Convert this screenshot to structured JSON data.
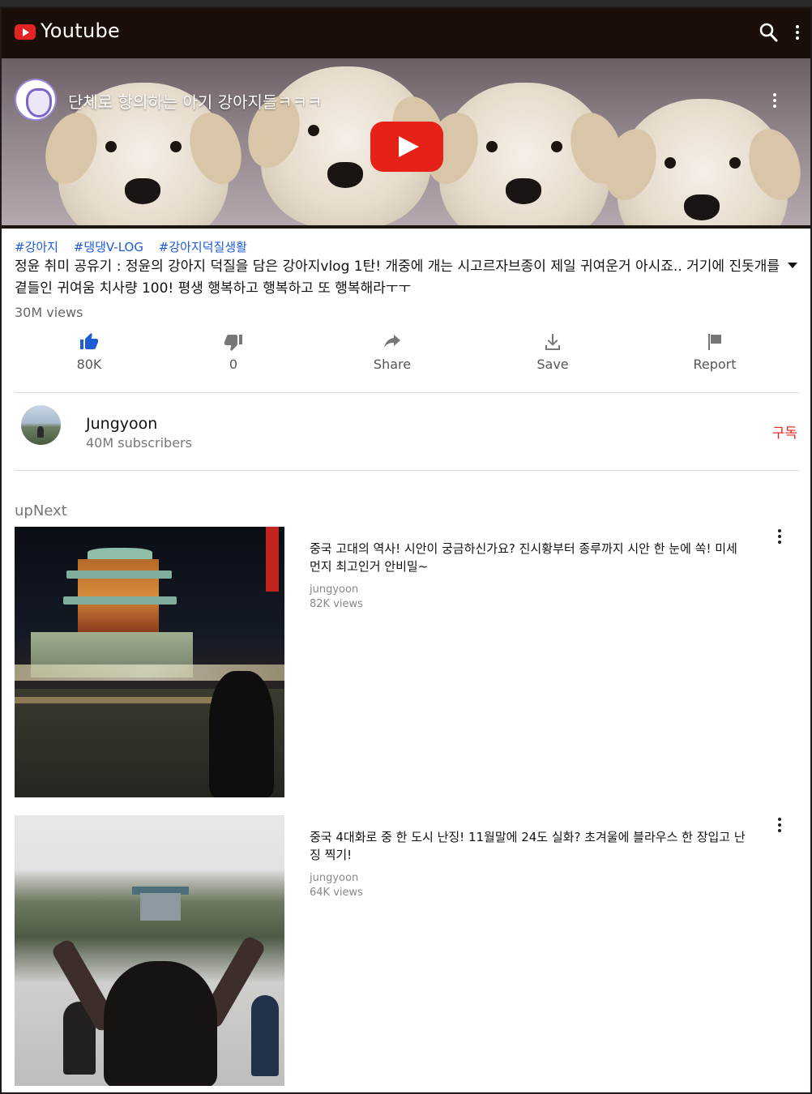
{
  "header": {
    "brand": "Youtube",
    "icons": [
      "youtube-logo-icon",
      "search-icon",
      "more-vert-icon"
    ],
    "colors": {
      "bar": "#1a0f08",
      "logo": "#e32424"
    }
  },
  "player": {
    "title": "단체로 항의하는 아기 강아지들ㅋㅋㅋ",
    "play_color": "#e62117"
  },
  "video": {
    "tags": [
      "#강아지",
      "#댕댕V-LOG",
      "#강아지덕질생활"
    ],
    "description": "정윤 취미 공유기 : 정윤의 강아지 덕질을 담은 강아지vlog 1탄! 개중에 개는 시고르자브종이 제일 귀여운거 아시죠.. 거기에 진돗개를 곁들인 귀여움 치사량 100! 평생 행복하고 행복하고 또 행복해라ㅜㅜ",
    "views": "30M views",
    "actions": {
      "like": "80K",
      "dislike": "0",
      "share": "Share",
      "save": "Save",
      "report": "Report"
    },
    "like_color": "#1e5bd6",
    "tag_color": "#1e5bd6"
  },
  "channel": {
    "name": "Jungyoon",
    "subscribers": "40M subscribers",
    "subscribe_label": "구독",
    "subscribe_color": "#e5261f"
  },
  "upnext": {
    "heading": "upNext",
    "items": [
      {
        "title": "중국 고대의 역사! 시안이 궁금하신가요? 진시황부터 종루까지 시안 한 눈에 쏙! 미세먼지 최고인거 안비밀~",
        "channel": "jungyoon",
        "views": "82K views"
      },
      {
        "title": "중국 4대화로 중 한 도시 난징! 11월말에 24도 실화? 초겨울에 블라우스 한 장입고 난징 찍기!",
        "channel": "jungyoon",
        "views": "64K views"
      }
    ]
  }
}
